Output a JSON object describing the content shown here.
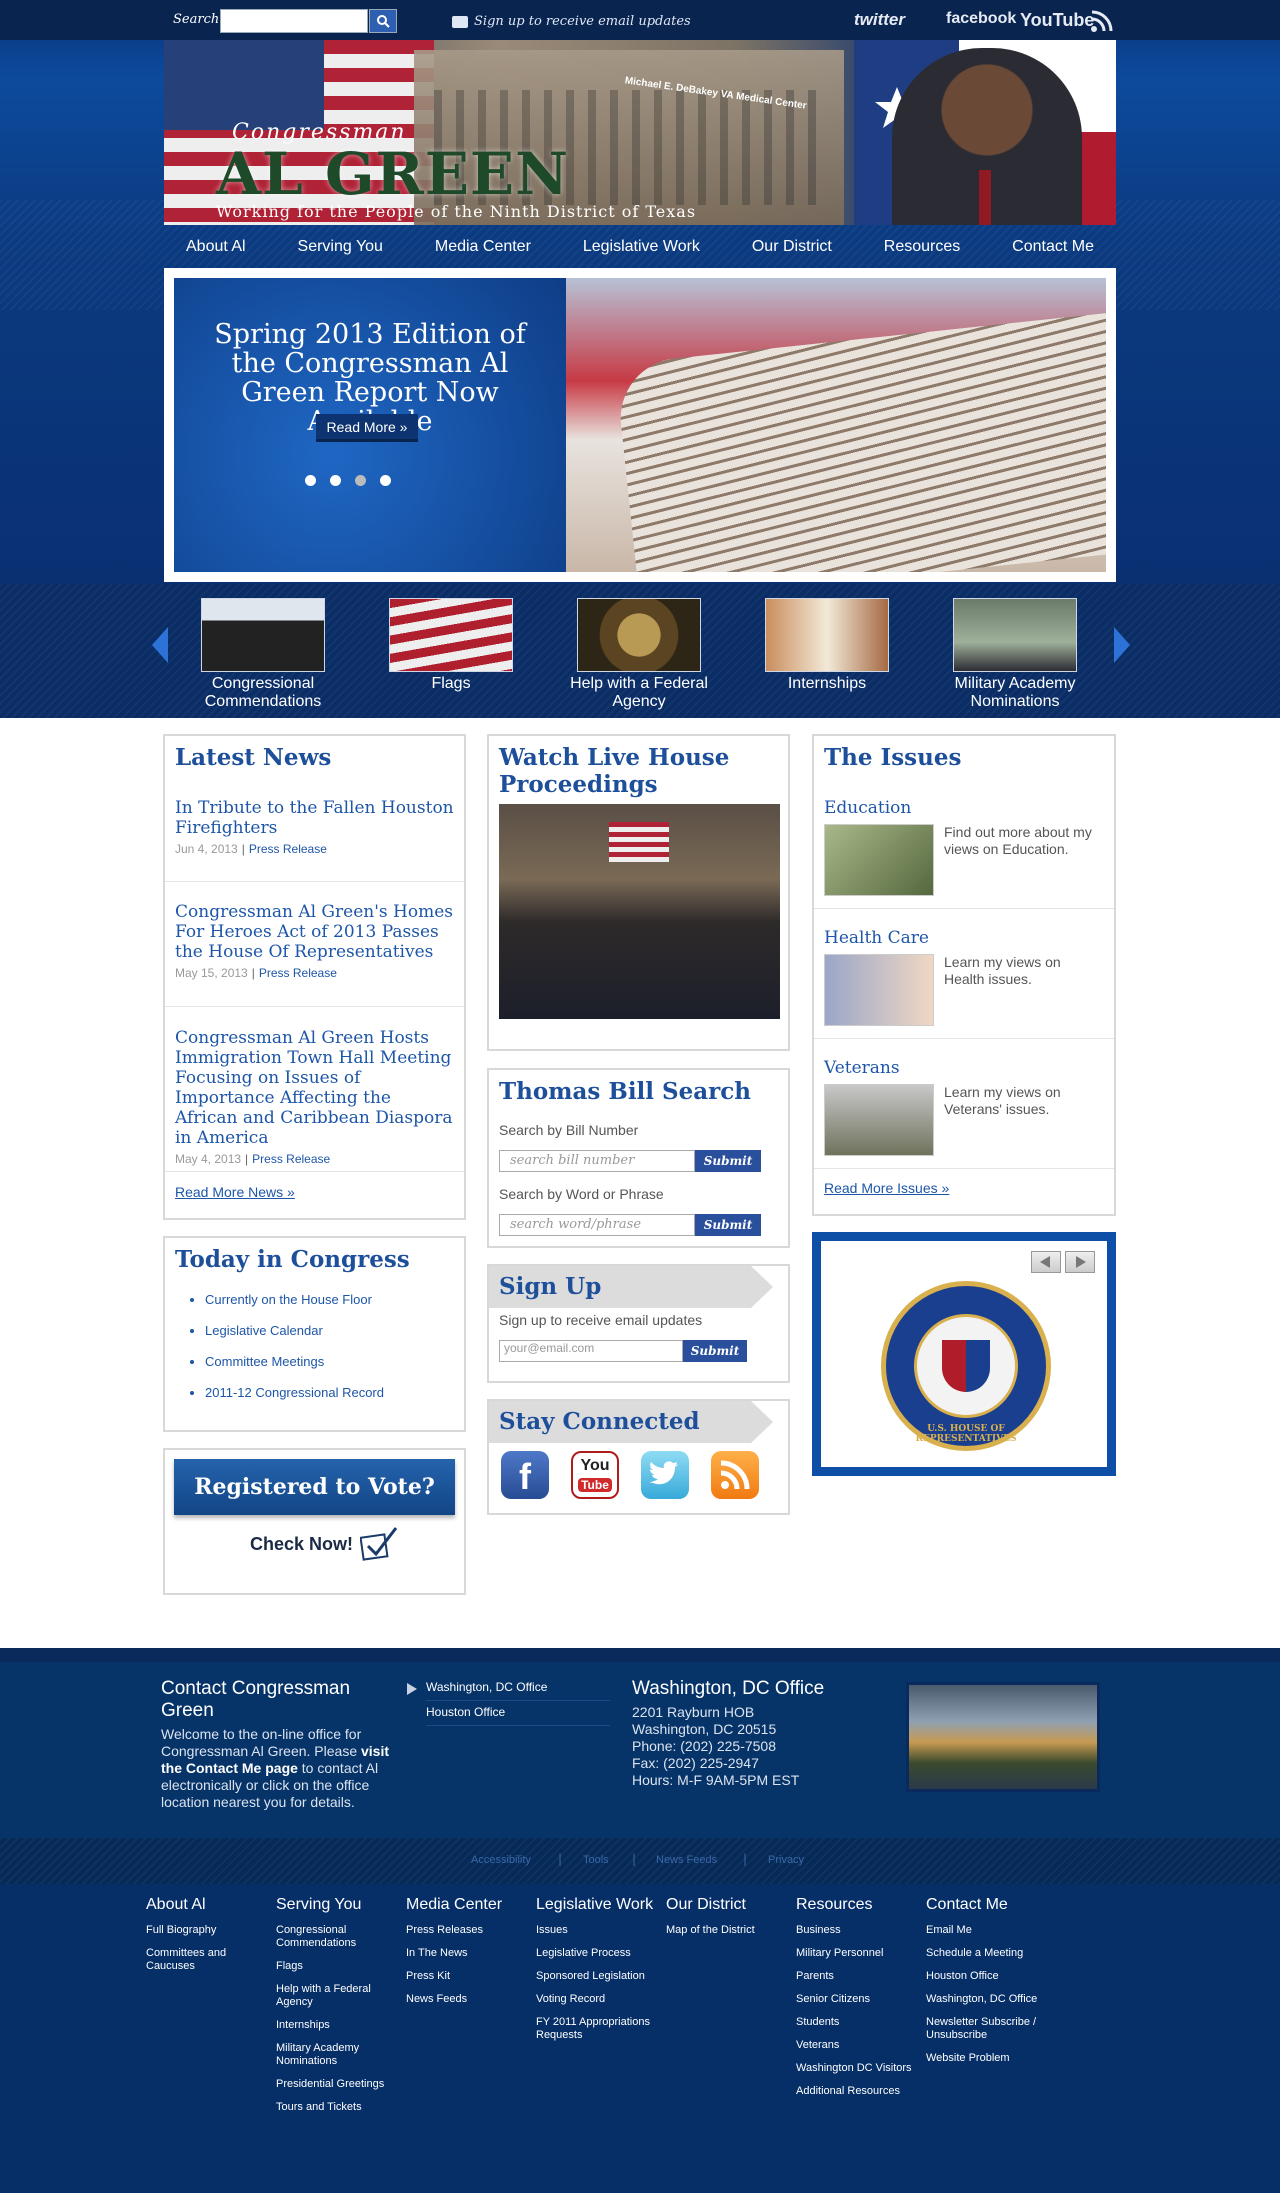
{
  "topbar": {
    "search_label": "Search",
    "signup_text": "Sign up to receive email updates",
    "social": {
      "twitter": "twitter",
      "facebook": "facebook",
      "youtube": "YouTube"
    }
  },
  "header": {
    "congressman": "Congressman",
    "name": "AL GREEN",
    "tagline": "Working for the People of the Ninth District of Texas",
    "building_sign": "Michael E. DeBakey VA Medical Center"
  },
  "nav": [
    "About Al",
    "Serving You",
    "Media Center",
    "Legislative Work",
    "Our District",
    "Resources",
    "Contact Me"
  ],
  "slider": {
    "title": "Spring 2013 Edition of the Congressman Al Green Report Now Available",
    "read_more": "Read More »",
    "dots": 4,
    "active_dot": 3
  },
  "carousel": [
    {
      "label": "Congressional Commendations"
    },
    {
      "label": "Flags"
    },
    {
      "label": "Help with a Federal Agency"
    },
    {
      "label": "Internships"
    },
    {
      "label": "Military Academy Nominations"
    }
  ],
  "latest_news": {
    "title": "Latest News",
    "items": [
      {
        "title": "In Tribute to the Fallen Houston Firefighters",
        "date": "Jun 4, 2013",
        "type": "Press Release"
      },
      {
        "title": "Congressman Al Green's Homes For Heroes Act of 2013 Passes the House Of Representatives",
        "date": "May 15, 2013",
        "type": "Press Release"
      },
      {
        "title": "Congressman Al Green Hosts Immigration Town Hall Meeting Focusing on Issues of Importance Affecting the African and Caribbean Diaspora in America",
        "date": "May 4, 2013",
        "type": "Press Release"
      }
    ],
    "more": "Read More News »"
  },
  "today": {
    "title": "Today in Congress",
    "items": [
      "Currently on the House Floor",
      "Legislative Calendar",
      "Committee Meetings",
      "2011-12 Congressional Record"
    ]
  },
  "vote": {
    "title": "Registered to Vote?",
    "subtitle": "Check Now!"
  },
  "live": {
    "title": "Watch Live House Proceedings"
  },
  "thomas": {
    "title": "Thomas Bill Search",
    "label1": "Search by Bill Number",
    "placeholder1": "search bill number",
    "label2": "Search by Word or Phrase",
    "placeholder2": "search word/phrase",
    "submit": "Submit"
  },
  "signup": {
    "title": "Sign Up",
    "text": "Sign up to receive email updates",
    "placeholder": "your@email.com",
    "submit": "Submit"
  },
  "stay": {
    "title": "Stay Connected",
    "icons": [
      "facebook-icon",
      "youtube-icon",
      "twitter-icon",
      "rss-icon"
    ],
    "youtube_label_1": "You",
    "youtube_label_2": "Tube"
  },
  "issues": {
    "title": "The Issues",
    "items": [
      {
        "title": "Education",
        "text": "Find out more about my views on Education."
      },
      {
        "title": "Health Care",
        "text": "Learn my views on Health issues."
      },
      {
        "title": "Veterans",
        "text": "Learn my views on Veterans' issues."
      }
    ],
    "more": "Read More Issues »"
  },
  "seal": {
    "text": "U.S. HOUSE OF REPRESENTATIVES"
  },
  "contact": {
    "title": "Contact Congressman Green",
    "text_1": "Welcome to the on-line office for Congressman Al Green. Please ",
    "text_bold": "visit the Contact Me page",
    "text_2": " to contact Al electronically or click on the office location nearest you for details.",
    "offices": [
      "Washington, DC Office",
      "Houston Office"
    ],
    "office_title": "Washington, DC Office",
    "office_lines": [
      "2201 Rayburn HOB",
      "Washington, DC 20515",
      "Phone: (202) 225-7508",
      "Fax: (202) 225-2947",
      "Hours: M-F 9AM-5PM EST"
    ]
  },
  "footer_links": [
    "Accessibility",
    "Tools",
    "News Feeds",
    "Privacy"
  ],
  "footer_cols": [
    {
      "head": "About Al",
      "links": [
        "Full Biography",
        "Committees and Caucuses"
      ]
    },
    {
      "head": "Serving You",
      "links": [
        "Congressional Commendations",
        "Flags",
        "Help with a Federal Agency",
        "Internships",
        "Military Academy Nominations",
        "Presidential Greetings",
        "Tours and Tickets"
      ]
    },
    {
      "head": "Media Center",
      "links": [
        "Press Releases",
        "In The News",
        "Press Kit",
        "News Feeds"
      ]
    },
    {
      "head": "Legislative Work",
      "links": [
        "Issues",
        "Legislative Process",
        "Sponsored Legislation",
        "Voting Record",
        "FY 2011 Appropriations Requests"
      ]
    },
    {
      "head": "Our District",
      "links": [
        "Map of the District"
      ]
    },
    {
      "head": "Resources",
      "links": [
        "Business",
        "Military Personnel",
        "Parents",
        "Senior Citizens",
        "Students",
        "Veterans",
        "Washington DC Visitors",
        "Additional Resources"
      ]
    },
    {
      "head": "Contact Me",
      "links": [
        "Email Me",
        "Schedule a Meeting",
        "Houston Office",
        "Washington, DC Office",
        "Newsletter Subscribe / Unsubscribe",
        "Website Problem"
      ]
    }
  ],
  "colors": {
    "navy": "#0a2a5e",
    "link_blue": "#1d56a8",
    "heading_blue": "#1d4f9a",
    "button_blue": "#2a4f9c"
  }
}
